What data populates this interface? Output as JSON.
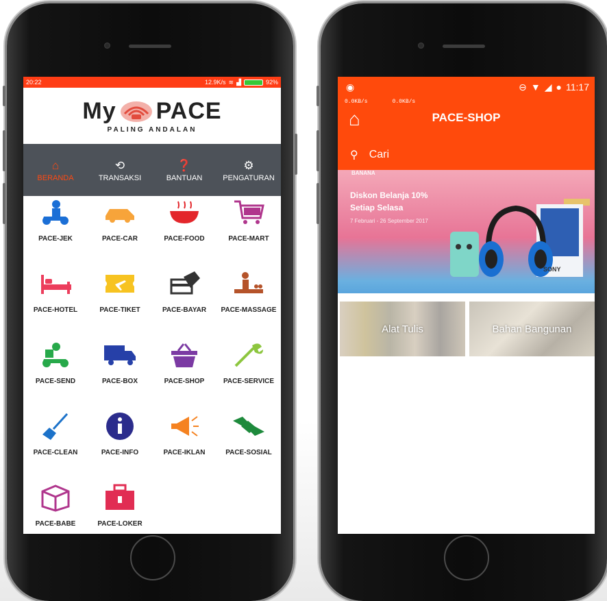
{
  "left_phone": {
    "status": {
      "time": "20:22",
      "speed": "12.9K/s",
      "battery": "92%"
    },
    "logo": {
      "text_left": "My",
      "text_right": "PACE",
      "tagline": "PALING ANDALAN"
    },
    "nav": [
      {
        "label": "BERANDA",
        "icon": "home-icon",
        "active": true
      },
      {
        "label": "TRANSAKSI",
        "icon": "history-icon",
        "active": false
      },
      {
        "label": "BANTUAN",
        "icon": "help-icon",
        "active": false
      },
      {
        "label": "PENGATURAN",
        "icon": "gear-icon",
        "active": false
      }
    ],
    "services": [
      {
        "label": "PACE-JEK",
        "icon": "scooter-rider-icon"
      },
      {
        "label": "PACE-CAR",
        "icon": "car-icon"
      },
      {
        "label": "PACE-FOOD",
        "icon": "food-bowl-icon"
      },
      {
        "label": "PACE-MART",
        "icon": "shopping-cart-icon"
      },
      {
        "label": "PACE-HOTEL",
        "icon": "bed-icon"
      },
      {
        "label": "PACE-TIKET",
        "icon": "plane-ticket-icon"
      },
      {
        "label": "PACE-BAYAR",
        "icon": "card-payment-icon"
      },
      {
        "label": "PACE-MASSAGE",
        "icon": "massage-icon"
      },
      {
        "label": "PACE-SEND",
        "icon": "delivery-scooter-icon"
      },
      {
        "label": "PACE-BOX",
        "icon": "truck-icon"
      },
      {
        "label": "PACE-SHOP",
        "icon": "basket-icon"
      },
      {
        "label": "PACE-SERVICE",
        "icon": "wrench-icon"
      },
      {
        "label": "PACE-CLEAN",
        "icon": "broom-icon"
      },
      {
        "label": "PACE-INFO",
        "icon": "info-icon"
      },
      {
        "label": "PACE-IKLAN",
        "icon": "megaphone-icon"
      },
      {
        "label": "PACE-SOSIAL",
        "icon": "handshake-icon"
      },
      {
        "label": "PACE-BABE",
        "icon": "box-icon"
      },
      {
        "label": "PACE-LOKER",
        "icon": "briefcase-icon"
      }
    ]
  },
  "right_phone": {
    "status": {
      "time": "11:17",
      "speed_down": "0.0KB/s",
      "speed_up": "0.0KB/s"
    },
    "title": "PACE-SHOP",
    "search_placeholder": "Cari",
    "banner": {
      "brand": "BANANA",
      "line1": "Diskon Belanja 10%",
      "line2": "Setiap Selasa",
      "date": "7 Februari - 26 September 2017",
      "product_label": "SONY"
    },
    "categories": [
      {
        "label": "Alat Tulis"
      },
      {
        "label": "Bahan Bangunan"
      }
    ]
  },
  "colors": {
    "brand_orange": "#ff4a0c",
    "nav_bg": "#4d5259",
    "nav_active": "#ff4a12"
  }
}
